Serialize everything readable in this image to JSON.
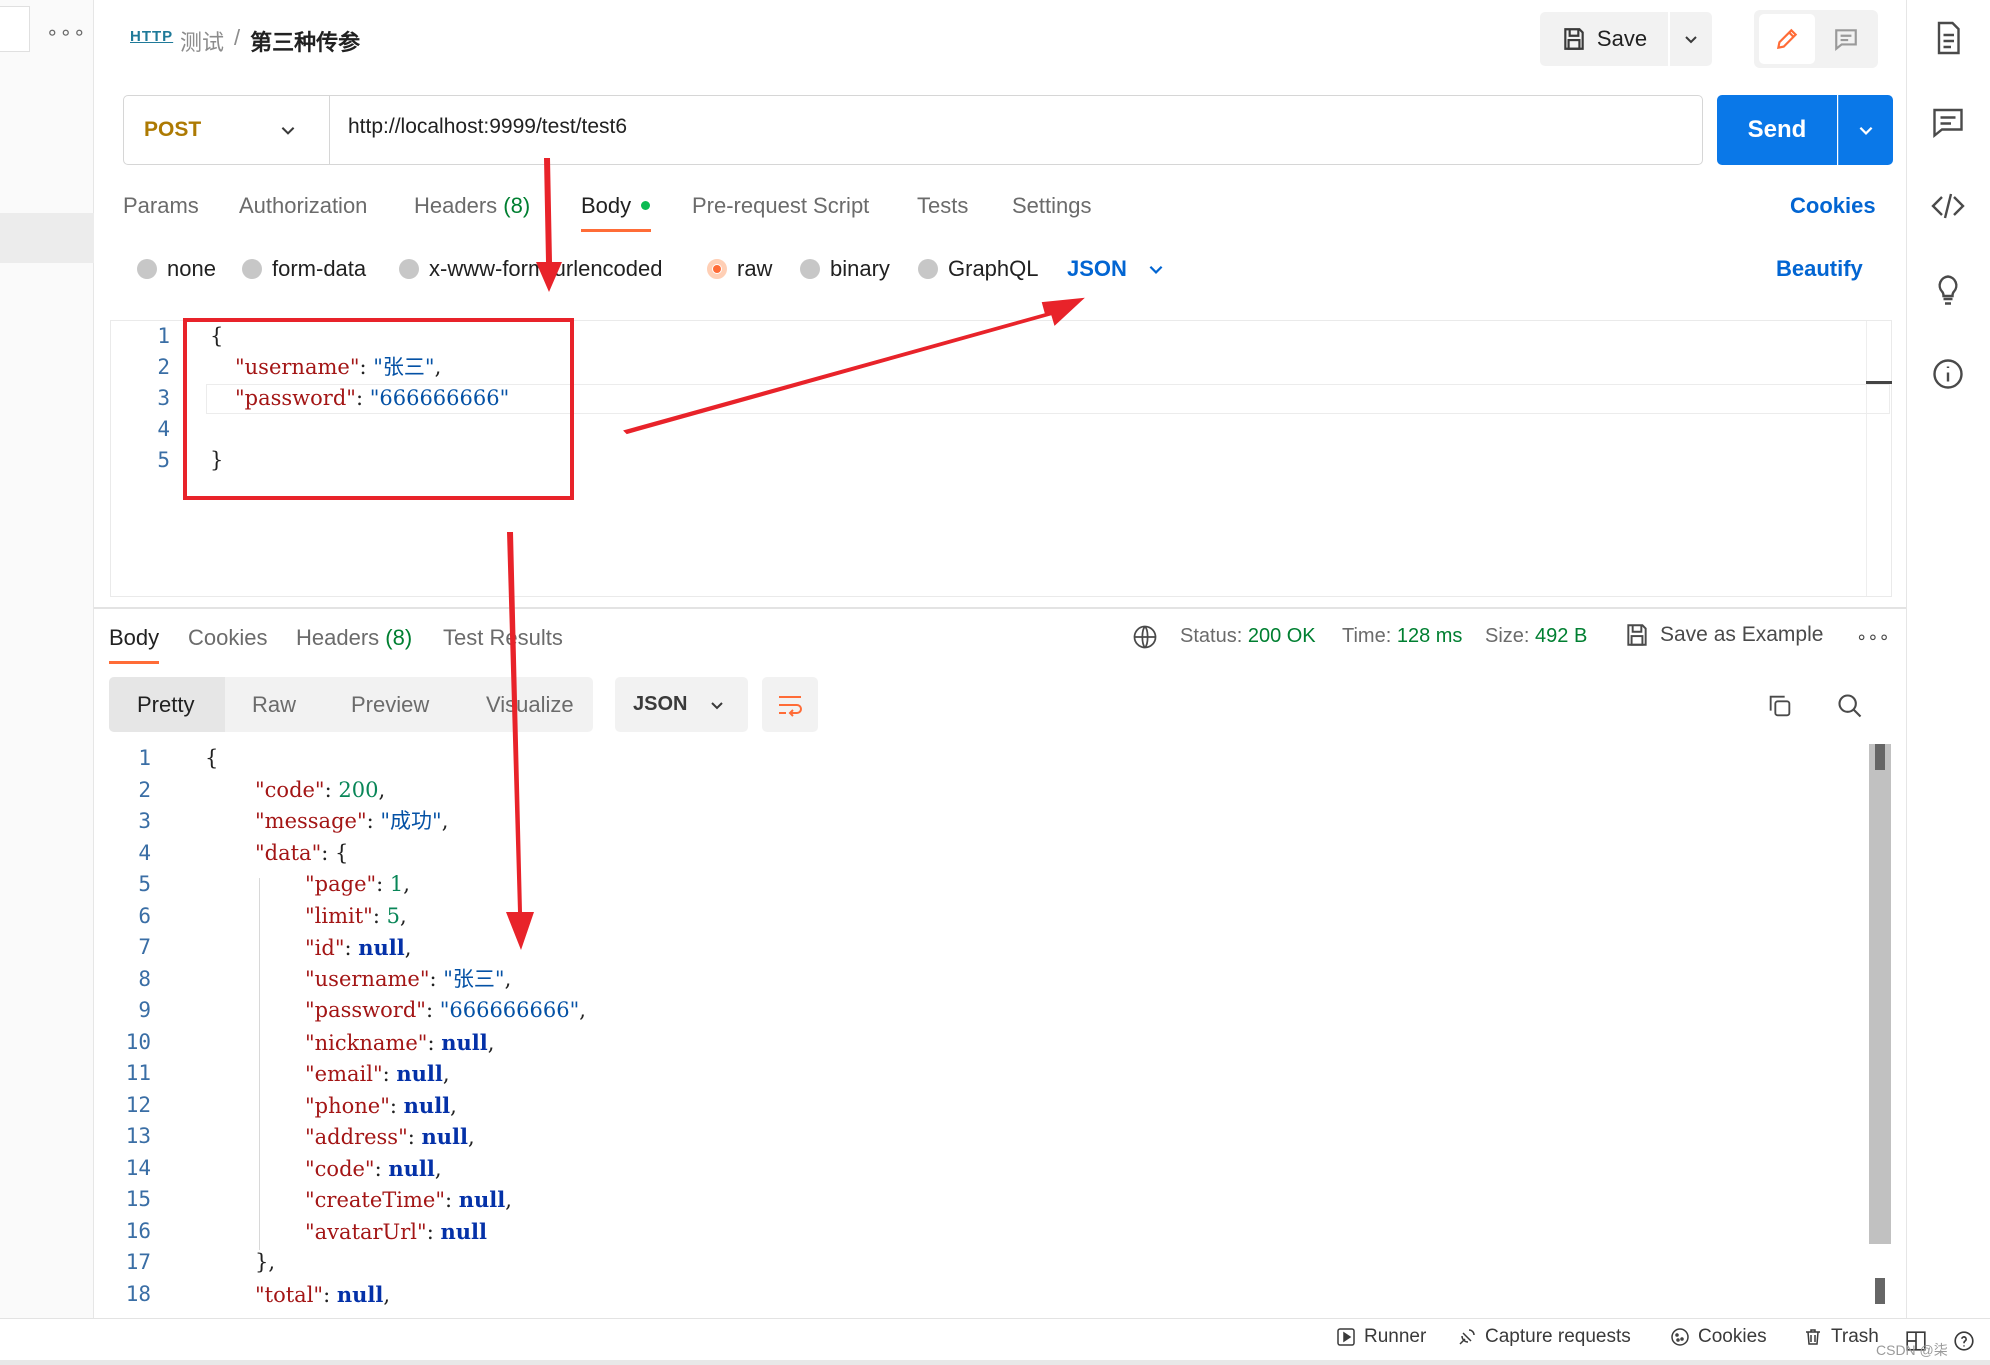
{
  "breadcrumb": {
    "icon_text": "HTTP",
    "parent": "测试",
    "separator": "/",
    "current": "第三种传参"
  },
  "toolbar": {
    "save_label": "Save"
  },
  "request": {
    "method": "POST",
    "url": "http://localhost:9999/test/test6",
    "send_label": "Send"
  },
  "request_tabs": {
    "params": "Params",
    "authorization": "Authorization",
    "headers": "Headers",
    "headers_count": "(8)",
    "body": "Body",
    "pre_request": "Pre-request Script",
    "tests": "Tests",
    "settings": "Settings",
    "cookies": "Cookies"
  },
  "body_types": {
    "none": "none",
    "form_data": "form-data",
    "urlencoded": "x-www-form-urlencoded",
    "raw": "raw",
    "binary": "binary",
    "graphql": "GraphQL",
    "format": "JSON",
    "beautify": "Beautify"
  },
  "request_body": {
    "line_numbers": [
      "1",
      "2",
      "3",
      "4",
      "5"
    ],
    "open_brace": "{",
    "username_key": "\"username\"",
    "username_value": "\"张三\"",
    "password_key": "\"password\"",
    "password_value": "\"666666666\"",
    "close_brace": "}"
  },
  "response_tabs": {
    "body": "Body",
    "cookies": "Cookies",
    "headers": "Headers",
    "headers_count": "(8)",
    "test_results": "Test Results"
  },
  "response_status": {
    "status_label": "Status:",
    "status_value": "200 OK",
    "time_label": "Time:",
    "time_value": "128 ms",
    "size_label": "Size:",
    "size_value": "492 B",
    "save_example": "Save as Example"
  },
  "view_modes": {
    "pretty": "Pretty",
    "raw": "Raw",
    "preview": "Preview",
    "visualize": "Visualize",
    "format": "JSON"
  },
  "response_body": {
    "line_numbers": [
      "1",
      "2",
      "3",
      "4",
      "5",
      "6",
      "7",
      "8",
      "9",
      "10",
      "11",
      "12",
      "13",
      "14",
      "15",
      "16",
      "17",
      "18"
    ],
    "lines": [
      {
        "k": "",
        "v": "{",
        "t": "pun"
      },
      {
        "k": "\"code\"",
        "v": "200",
        "t": "num",
        "c": ","
      },
      {
        "k": "\"message\"",
        "v": "\"成功\"",
        "t": "str",
        "c": ","
      },
      {
        "k": "\"data\"",
        "v": "{",
        "t": "pun"
      },
      {
        "k": "\"page\"",
        "v": "1",
        "t": "num",
        "c": ","
      },
      {
        "k": "\"limit\"",
        "v": "5",
        "t": "num",
        "c": ","
      },
      {
        "k": "\"id\"",
        "v": "null",
        "t": "nul",
        "c": ","
      },
      {
        "k": "\"username\"",
        "v": "\"张三\"",
        "t": "str",
        "c": ","
      },
      {
        "k": "\"password\"",
        "v": "\"666666666\"",
        "t": "str",
        "c": ","
      },
      {
        "k": "\"nickname\"",
        "v": "null",
        "t": "nul",
        "c": ","
      },
      {
        "k": "\"email\"",
        "v": "null",
        "t": "nul",
        "c": ","
      },
      {
        "k": "\"phone\"",
        "v": "null",
        "t": "nul",
        "c": ","
      },
      {
        "k": "\"address\"",
        "v": "null",
        "t": "nul",
        "c": ","
      },
      {
        "k": "\"code\"",
        "v": "null",
        "t": "nul",
        "c": ","
      },
      {
        "k": "\"createTime\"",
        "v": "null",
        "t": "nul",
        "c": ","
      },
      {
        "k": "\"avatarUrl\"",
        "v": "null",
        "t": "nul"
      },
      {
        "k": "",
        "v": "},",
        "t": "pun"
      },
      {
        "k": "\"total\"",
        "v": "null",
        "t": "nul",
        "c": ","
      }
    ]
  },
  "footer": {
    "runner": "Runner",
    "capture": "Capture requests",
    "cookies": "Cookies",
    "trash": "Trash",
    "watermark": "CSDN @柒"
  },
  "colors": {
    "accent": "#ff6c37",
    "primary": "#0265d2",
    "send_bg": "#0a78e8",
    "success": "#007f31",
    "annotation": "#e8232a"
  }
}
